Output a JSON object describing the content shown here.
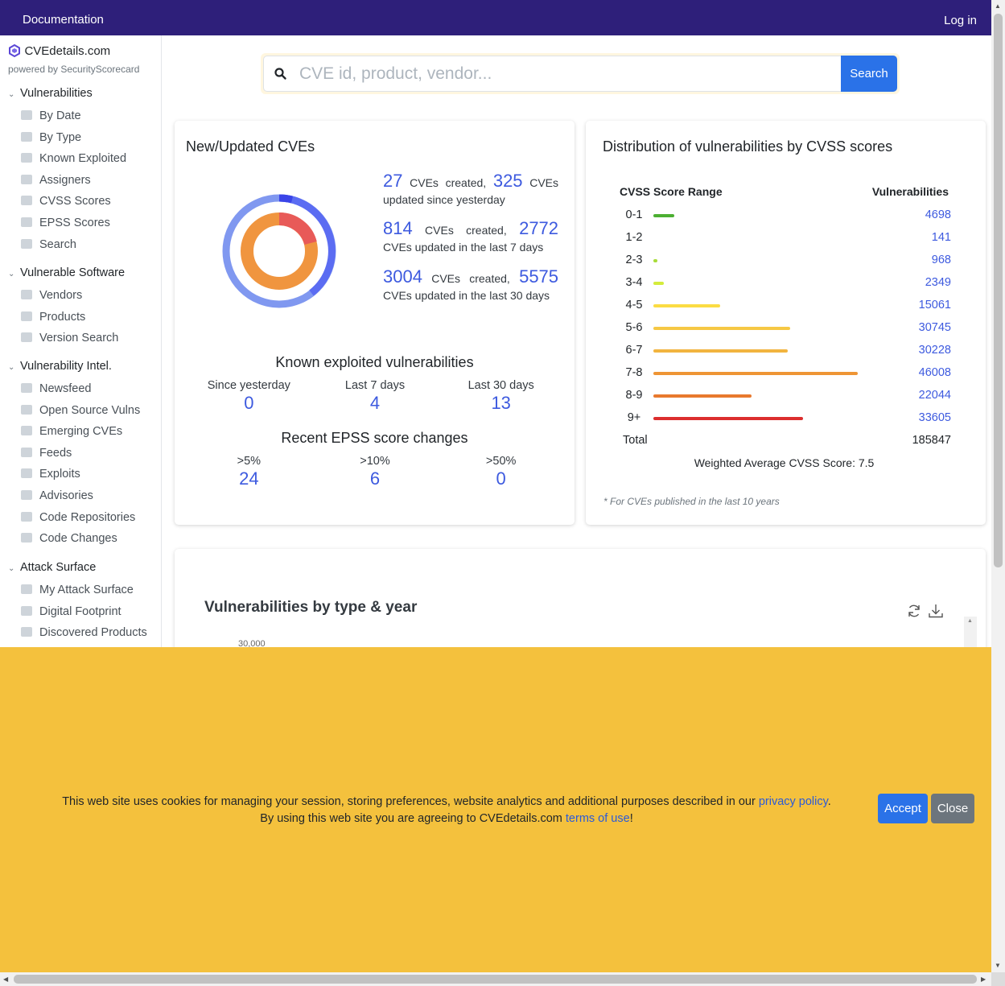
{
  "topbar": {
    "documentation": "Documentation",
    "login": "Log in"
  },
  "brand": {
    "name": "CVEdetails.com",
    "powered": "powered by SecurityScorecard"
  },
  "sidebar": {
    "sections": [
      {
        "title": "Vulnerabilities",
        "items": [
          "By Date",
          "By Type",
          "Known Exploited",
          "Assigners",
          "CVSS Scores",
          "EPSS Scores",
          "Search"
        ]
      },
      {
        "title": "Vulnerable Software",
        "items": [
          "Vendors",
          "Products",
          "Version Search"
        ]
      },
      {
        "title": "Vulnerability Intel.",
        "items": [
          "Newsfeed",
          "Open Source Vulns",
          "Emerging CVEs",
          "Feeds",
          "Exploits",
          "Advisories",
          "Code Repositories",
          "Code Changes"
        ]
      },
      {
        "title": "Attack Surface",
        "items": [
          "My Attack Surface",
          "Digital Footprint",
          "Discovered Products"
        ]
      }
    ]
  },
  "search": {
    "placeholder": "CVE id, product, vendor...",
    "button": "Search"
  },
  "new_updated": {
    "title": "New/Updated CVEs",
    "yesterday": {
      "created": "27",
      "created_lbl": "CVEs created,",
      "updated": "325",
      "updated_lbl": "CVEs updated since yesterday"
    },
    "week": {
      "created": "814",
      "created_lbl": "CVEs created,",
      "updated": "2772",
      "updated_lbl": "CVEs updated in the last 7 days"
    },
    "month": {
      "created": "3004",
      "created_lbl": "CVEs created,",
      "updated": "5575",
      "updated_lbl": "CVEs updated in the last 30 days"
    },
    "kev_title": "Known exploited vulnerabilities",
    "kev": [
      {
        "label": "Since yesterday",
        "value": "0"
      },
      {
        "label": "Last 7 days",
        "value": "4"
      },
      {
        "label": "Last 30 days",
        "value": "13"
      }
    ],
    "epss_title": "Recent EPSS score changes",
    "epss": [
      {
        "label": ">5%",
        "value": "24"
      },
      {
        "label": ">10%",
        "value": "6"
      },
      {
        "label": ">50%",
        "value": "0"
      }
    ]
  },
  "distribution": {
    "title": "Distribution of vulnerabilities by CVSS scores",
    "col_range": "CVSS Score Range",
    "col_vulns": "Vulnerabilities",
    "total_label": "Total",
    "total": "185847",
    "weighted": "Weighted Average CVSS Score: 7.5",
    "footnote": "* For CVEs published in the last 10 years"
  },
  "chart_data": {
    "type": "bar",
    "categories": [
      "0-1",
      "1-2",
      "2-3",
      "3-4",
      "4-5",
      "5-6",
      "6-7",
      "7-8",
      "8-9",
      "9+"
    ],
    "values": [
      4698,
      141,
      968,
      2349,
      15061,
      30745,
      30228,
      46008,
      22044,
      33605
    ],
    "colors": [
      "#4caf32",
      "#8ed037",
      "#a8dc3a",
      "#d4ec3c",
      "#fbdc43",
      "#f6c844",
      "#f2b43f",
      "#ee9535",
      "#e8792e",
      "#dc2e2e"
    ],
    "xlabel": "CVSS Score Range",
    "ylabel": "Vulnerabilities"
  },
  "type_year": {
    "title": "Vulnerabilities by type & year",
    "first_tick": "30,000"
  },
  "cookie": {
    "text1": "This web site uses cookies for managing your session, storing preferences, website analytics and additional purposes described in our ",
    "privacy": "privacy policy",
    "text2": ".",
    "text3": "By using this web site you are agreeing to CVEdetails.com ",
    "terms": "terms of use",
    "text4": "!",
    "accept": "Accept",
    "close": "Close"
  },
  "accent": "#3d5adf",
  "brand_color": "#2e1f7a",
  "cookie_color": "#f4c13d"
}
